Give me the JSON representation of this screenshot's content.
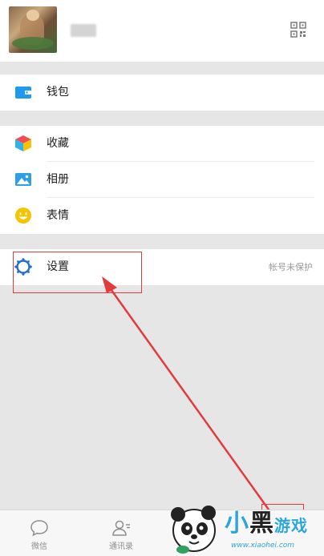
{
  "profile": {
    "name": "",
    "avatar_icon": "avatar-photo",
    "qr_icon": "qr-code-icon"
  },
  "menu": {
    "wallet": {
      "label": "钱包",
      "icon": "wallet-icon",
      "color": "#1e9bf0"
    },
    "favorites": {
      "label": "收藏",
      "icon": "favorites-cube-icon"
    },
    "album": {
      "label": "相册",
      "icon": "album-icon",
      "color": "#2f9ee8"
    },
    "stickers": {
      "label": "表情",
      "icon": "smiley-icon",
      "color": "#f5c400"
    },
    "settings": {
      "label": "设置",
      "icon": "gear-icon",
      "status": "帐号未保护",
      "color": "#1e6fd9"
    }
  },
  "tabbar": {
    "tabs": [
      {
        "label": "微信",
        "icon": "chat-bubble-icon"
      },
      {
        "label": "通讯录",
        "icon": "contacts-icon"
      }
    ]
  },
  "annotations": {
    "highlight_color": "#e43a3a"
  },
  "watermark": {
    "brand_part1": "小",
    "brand_part2": "黑",
    "brand_part3": "游戏",
    "url": "www.xiaohei.com"
  }
}
